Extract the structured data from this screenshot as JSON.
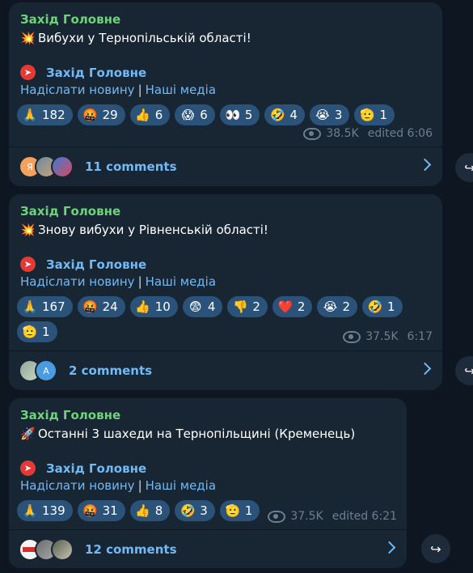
{
  "posts": [
    {
      "author": "Захід Головне",
      "emoji": "💥",
      "text": "Вибухи у Тернопільській області!",
      "channel": "Захід Головне",
      "link1": "Надіслати новину",
      "link2": "Наші медіа",
      "separator": "|",
      "reactions_row1": [
        {
          "icon": "🙏",
          "count": "182"
        },
        {
          "icon": "🤬",
          "count": "29"
        },
        {
          "icon": "👍",
          "count": "6"
        },
        {
          "icon": "😱",
          "count": "6"
        },
        {
          "icon": "👀",
          "count": "5"
        },
        {
          "icon": "🤣",
          "count": "4"
        },
        {
          "icon": "😭",
          "count": "3"
        },
        {
          "icon": "🫡",
          "count": "1"
        }
      ],
      "views": "38.5K",
      "time": "edited 6:06",
      "avatar1_letter": "Я",
      "comments": "11 comments"
    },
    {
      "author": "Захід Головне",
      "emoji": "💥",
      "text": "Знову вибухи у Рівненській області!",
      "channel": "Захід Головне",
      "link1": "Надіслати новину",
      "link2": "Наші медіа",
      "separator": "|",
      "reactions_row1": [
        {
          "icon": "🙏",
          "count": "167"
        },
        {
          "icon": "🤬",
          "count": "24"
        },
        {
          "icon": "👍",
          "count": "10"
        },
        {
          "icon": "😨",
          "count": "4"
        },
        {
          "icon": "👎",
          "count": "2"
        },
        {
          "icon": "❤️",
          "count": "2"
        },
        {
          "icon": "😭",
          "count": "2"
        },
        {
          "icon": "🤣",
          "count": "1"
        }
      ],
      "reactions_row2": [
        {
          "icon": "🫡",
          "count": "1"
        }
      ],
      "views": "37.5K",
      "time": "6:17",
      "avatar2_letter": "A",
      "comments": "2 comments"
    },
    {
      "author": "Захід Головне",
      "emoji": "🚀",
      "text": "Останні 3 шахеди на Тернопільщині (Кременець)",
      "channel": "Захід Головне",
      "link1": "Надіслати новину",
      "link2": "Наші медіа",
      "separator": "|",
      "reactions_row1": [
        {
          "icon": "🙏",
          "count": "139"
        },
        {
          "icon": "🤬",
          "count": "31"
        },
        {
          "icon": "👍",
          "count": "8"
        },
        {
          "icon": "🤣",
          "count": "3"
        },
        {
          "icon": "🫡",
          "count": "1"
        }
      ],
      "views": "37.5K",
      "time": "edited 6:21",
      "comments": "12 comments"
    }
  ],
  "share_icon": "↪"
}
